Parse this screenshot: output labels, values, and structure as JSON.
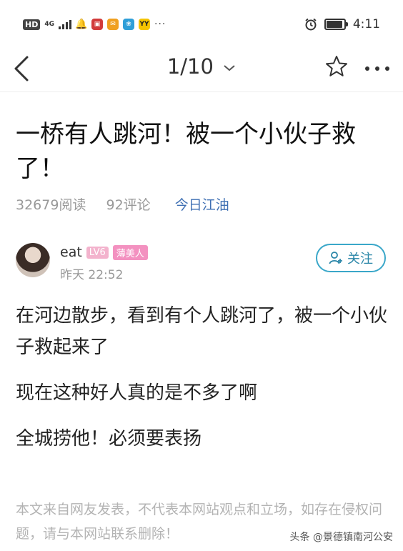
{
  "status_bar": {
    "hd": "HD",
    "network": "4G",
    "time": "4:11",
    "battery_level": 0.85,
    "more": "···",
    "apps": [
      {
        "icon": "bell-icon",
        "color": "#555555"
      },
      {
        "icon": "news-app-icon",
        "color": "#d23b3b"
      },
      {
        "icon": "mail-app-icon",
        "color": "#f0a020"
      },
      {
        "icon": "leaf-app-icon",
        "color": "#2f9fd8"
      },
      {
        "icon": "yy-app-icon",
        "color": "#f5c400",
        "text": "YY"
      }
    ]
  },
  "nav": {
    "pager": "1/10"
  },
  "article": {
    "title": "一桥有人跳河！被一个小伙子救了！",
    "reads": "32679阅读",
    "comments": "92评论",
    "source": "今日江油"
  },
  "author": {
    "name": "eat",
    "level": "LV6",
    "tag": "薄美人",
    "time": "昨天 22:52",
    "follow_label": "关注"
  },
  "body": {
    "paragraphs": [
      "在河边散步，看到有个人跳河了，被一个小伙子救起来了",
      "现在这种好人真的是不多了啊",
      "全城捞他！必须要表扬"
    ]
  },
  "disclaimer": "本文来自网友发表，不代表本网站观点和立场，如存在侵权问题，请与本网站联系删除！",
  "watermark": "头条 @景德镇南河公安",
  "colors": {
    "accent": "#3aa7c9",
    "source_link": "#3e6fb3",
    "tag_pink": "#f391c0"
  }
}
